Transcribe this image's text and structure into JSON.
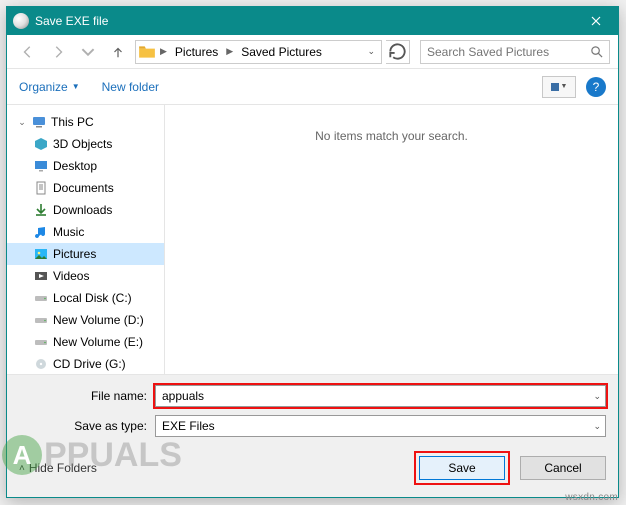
{
  "title": "Save EXE file",
  "breadcrumbs": {
    "a": "Pictures",
    "b": "Saved Pictures"
  },
  "search": {
    "placeholder": "Search Saved Pictures"
  },
  "toolbar": {
    "organize": "Organize",
    "newfolder": "New folder"
  },
  "tree": {
    "root": "This PC",
    "items": {
      "0": "3D Objects",
      "1": "Desktop",
      "2": "Documents",
      "3": "Downloads",
      "4": "Music",
      "5": "Pictures",
      "6": "Videos",
      "7": "Local Disk (C:)",
      "8": "New Volume (D:)",
      "9": "New Volume (E:)",
      "10": "CD Drive (G:)"
    }
  },
  "content": {
    "empty": "No items match your search."
  },
  "filename": {
    "label": "File name:",
    "value": "appuals"
  },
  "saveastype": {
    "label": "Save as type:",
    "value": "EXE Files"
  },
  "actions": {
    "hide": "Hide Folders",
    "save": "Save",
    "cancel": "Cancel"
  },
  "watermark": "wsxdn.com",
  "brand": "PPUALS"
}
